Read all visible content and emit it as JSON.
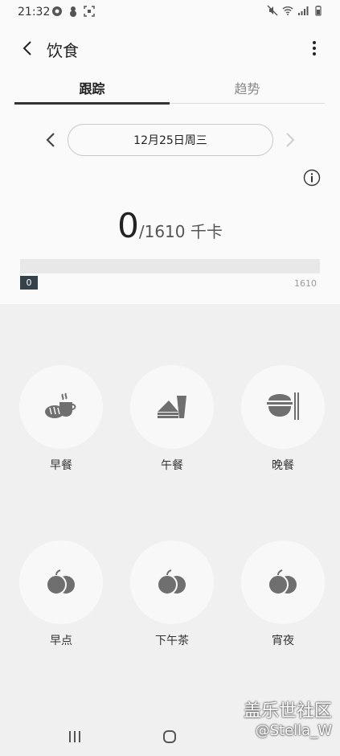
{
  "status_bar": {
    "time": "21:32"
  },
  "app_bar": {
    "title": "饮食"
  },
  "tabs": [
    {
      "label": "跟踪",
      "active": true
    },
    {
      "label": "趋势",
      "active": false
    }
  ],
  "date": {
    "label": "12月25日周三"
  },
  "calories": {
    "consumed": "0",
    "goal_text": "/1610 千卡",
    "progress_fraction": 0,
    "marker_value": "0",
    "max_value": "1610"
  },
  "meals": [
    {
      "label": "早餐",
      "icon": "breakfast-icon"
    },
    {
      "label": "午餐",
      "icon": "lunch-icon"
    },
    {
      "label": "晚餐",
      "icon": "dinner-icon"
    },
    {
      "label": "早点",
      "icon": "snack-icon"
    },
    {
      "label": "下午茶",
      "icon": "snack-icon"
    },
    {
      "label": "宵夜",
      "icon": "snack-icon"
    }
  ],
  "watermark": {
    "line1": "盖乐世社区",
    "line2": "@Stella_W"
  },
  "colors": {
    "accent": "#36424a",
    "icon_gray": "#6f6f6f",
    "background": "#f0f0f0"
  }
}
